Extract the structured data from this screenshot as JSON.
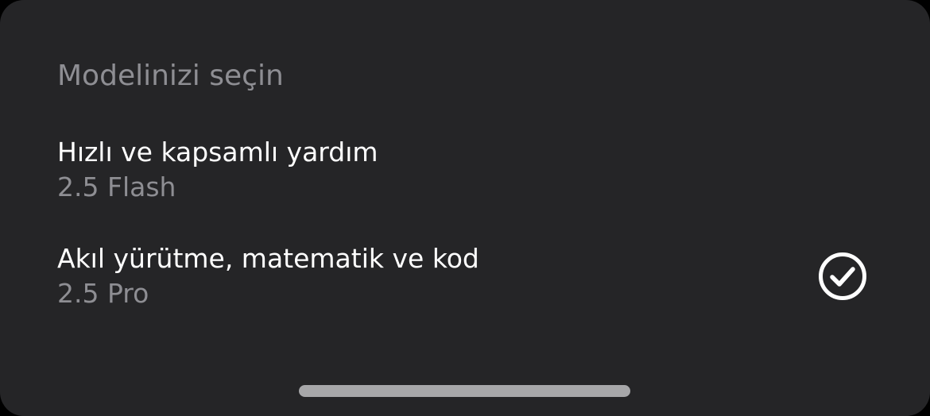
{
  "sheet": {
    "title": "Modelinizi seçin",
    "options": [
      {
        "label": "Hızlı ve kapsamlı yardım",
        "model": "2.5 Flash",
        "selected": false
      },
      {
        "label": "Akıl yürütme, matematik ve kod",
        "model": "2.5 Pro",
        "selected": true
      }
    ],
    "check_icon": "checkmark-circle-icon"
  },
  "colors": {
    "background": "#252527",
    "primary_text": "#ffffff",
    "secondary_text": "#8e8e93",
    "home_indicator": "#a7a7a9"
  }
}
